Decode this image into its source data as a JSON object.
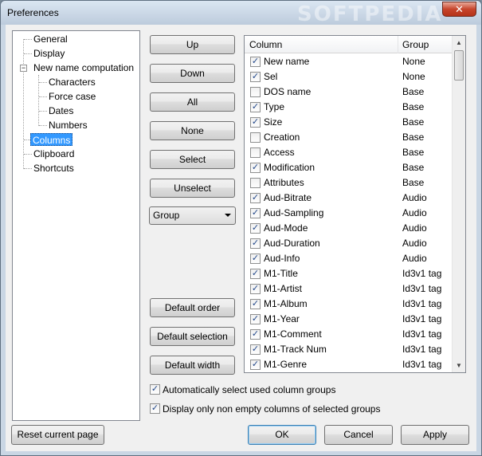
{
  "window": {
    "title": "Preferences",
    "close_glyph": "✕",
    "watermark": "SOFTPEDIA"
  },
  "tree": {
    "items": [
      {
        "label": "General",
        "level": 0
      },
      {
        "label": "Display",
        "level": 0
      },
      {
        "label": "New name computation",
        "level": 0,
        "expanded": true
      },
      {
        "label": "Characters",
        "level": 1
      },
      {
        "label": "Force case",
        "level": 1
      },
      {
        "label": "Dates",
        "level": 1
      },
      {
        "label": "Numbers",
        "level": 1
      },
      {
        "label": "Columns",
        "level": 0,
        "selected": true
      },
      {
        "label": "Clipboard",
        "level": 0
      },
      {
        "label": "Shortcuts",
        "level": 0
      }
    ],
    "expander_glyph": "−"
  },
  "buttons": {
    "up": "Up",
    "down": "Down",
    "all": "All",
    "none": "None",
    "select": "Select",
    "unselect": "Unselect",
    "default_order": "Default order",
    "default_selection": "Default selection",
    "default_width": "Default width",
    "reset": "Reset current page",
    "ok": "OK",
    "cancel": "Cancel",
    "apply": "Apply"
  },
  "combo": {
    "value": "Group"
  },
  "columns_list": {
    "headers": {
      "column": "Column",
      "group": "Group"
    },
    "check_glyph": "✓",
    "rows": [
      {
        "name": "New name",
        "group": "None",
        "checked": true
      },
      {
        "name": "Sel",
        "group": "None",
        "checked": true
      },
      {
        "name": "DOS name",
        "group": "Base",
        "checked": false
      },
      {
        "name": "Type",
        "group": "Base",
        "checked": true
      },
      {
        "name": "Size",
        "group": "Base",
        "checked": true
      },
      {
        "name": "Creation",
        "group": "Base",
        "checked": false
      },
      {
        "name": "Access",
        "group": "Base",
        "checked": false
      },
      {
        "name": "Modification",
        "group": "Base",
        "checked": true
      },
      {
        "name": "Attributes",
        "group": "Base",
        "checked": false
      },
      {
        "name": "Aud-Bitrate",
        "group": "Audio",
        "checked": true
      },
      {
        "name": "Aud-Sampling",
        "group": "Audio",
        "checked": true
      },
      {
        "name": "Aud-Mode",
        "group": "Audio",
        "checked": true
      },
      {
        "name": "Aud-Duration",
        "group": "Audio",
        "checked": true
      },
      {
        "name": "Aud-Info",
        "group": "Audio",
        "checked": true
      },
      {
        "name": "M1-Title",
        "group": "Id3v1 tag",
        "checked": true
      },
      {
        "name": "M1-Artist",
        "group": "Id3v1 tag",
        "checked": true
      },
      {
        "name": "M1-Album",
        "group": "Id3v1 tag",
        "checked": true
      },
      {
        "name": "M1-Year",
        "group": "Id3v1 tag",
        "checked": true
      },
      {
        "name": "M1-Comment",
        "group": "Id3v1 tag",
        "checked": true
      },
      {
        "name": "M1-Track Num",
        "group": "Id3v1 tag",
        "checked": true
      },
      {
        "name": "M1-Genre",
        "group": "Id3v1 tag",
        "checked": true
      }
    ],
    "scroll": {
      "up_glyph": "▲",
      "down_glyph": "▼"
    }
  },
  "options": {
    "auto_select": {
      "label": "Automatically select used column groups",
      "checked": true
    },
    "non_empty": {
      "label": "Display only non empty columns of selected groups",
      "checked": true
    }
  }
}
